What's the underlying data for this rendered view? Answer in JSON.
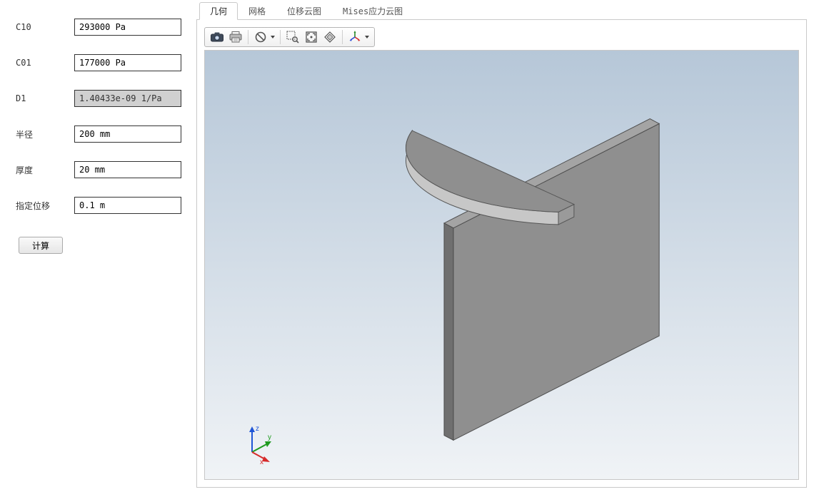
{
  "form": {
    "fields": [
      {
        "label": "C10",
        "value": "293000 Pa",
        "readonly": false
      },
      {
        "label": "C01",
        "value": "177000 Pa",
        "readonly": false
      },
      {
        "label": "D1",
        "value": "1.40433e-09 1/Pa",
        "readonly": true
      },
      {
        "label": "半径",
        "value": "200 mm",
        "readonly": false
      },
      {
        "label": "厚度",
        "value": "20 mm",
        "readonly": false
      },
      {
        "label": "指定位移",
        "value": "0.1 m",
        "readonly": false
      }
    ],
    "compute_label": "计算"
  },
  "tabs": [
    {
      "label": "几何",
      "active": true
    },
    {
      "label": "网格",
      "active": false
    },
    {
      "label": "位移云图",
      "active": false
    },
    {
      "label": "Mises应力云图",
      "active": false
    }
  ],
  "toolbar": {
    "items": [
      {
        "name": "screenshot-icon"
      },
      {
        "name": "print-icon"
      },
      {
        "sep": true
      },
      {
        "name": "no-entry-icon",
        "dropdown": true
      },
      {
        "sep": true
      },
      {
        "name": "zoom-box-icon"
      },
      {
        "name": "zoom-extents-icon"
      },
      {
        "name": "rotate-icon"
      },
      {
        "sep": true
      },
      {
        "name": "axes-icon",
        "dropdown": true
      }
    ]
  },
  "axes": {
    "z": "z",
    "y": "y",
    "x": "x"
  },
  "colors": {
    "solid_fill": "#8f8f8f",
    "solid_edge": "#555555",
    "viewport_top": "#b6c7d8",
    "viewport_bottom": "#f0f3f6"
  }
}
